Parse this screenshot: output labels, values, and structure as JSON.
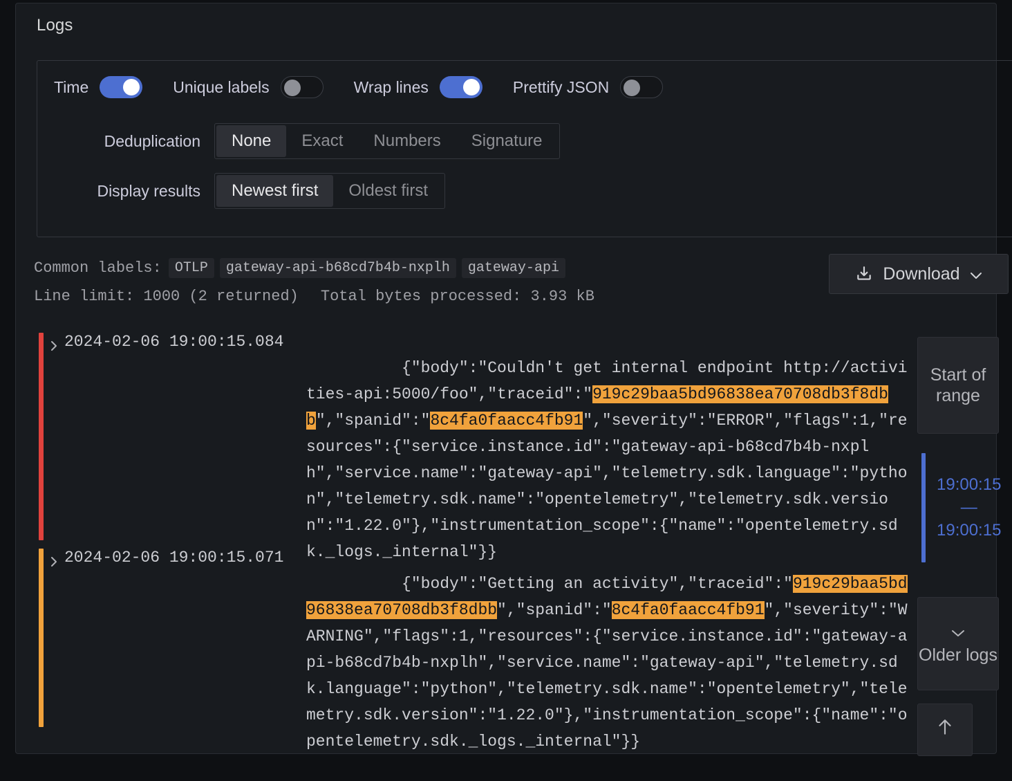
{
  "panel": {
    "title": "Logs"
  },
  "options": {
    "toggles": [
      {
        "label": "Time",
        "state": "on",
        "icon": "toggle-switch"
      },
      {
        "label": "Unique labels",
        "state": "off",
        "icon": "toggle-switch"
      },
      {
        "label": "Wrap lines",
        "state": "on",
        "icon": "toggle-switch"
      },
      {
        "label": "Prettify JSON",
        "state": "off",
        "icon": "toggle-switch"
      }
    ],
    "deduplication": {
      "label": "Deduplication",
      "options": [
        "None",
        "Exact",
        "Numbers",
        "Signature"
      ],
      "selected": "None"
    },
    "display_results": {
      "label": "Display results",
      "options": [
        "Newest first",
        "Oldest first"
      ],
      "selected": "Newest first"
    }
  },
  "meta": {
    "common_labels_key": "Common labels:",
    "common_labels": [
      "OTLP",
      "gateway-api-b68cd7b4b-nxplh",
      "gateway-api"
    ],
    "line_limit": "Line limit: 1000 (2 returned)",
    "total_bytes": "Total bytes processed: 3.93 kB"
  },
  "download": {
    "label": "Download",
    "icon": "download-icon",
    "caret": "chevron-down-icon"
  },
  "logs": [
    {
      "timestamp": "2024-02-06 19:00:15.084",
      "severity": "ERROR",
      "severity_color": "#e0423d",
      "segments": [
        {
          "text": "{\"body\":\"Couldn't get internal endpoint http://activities-api:5000/foo\",\"traceid\":\"",
          "highlight": false
        },
        {
          "text": "919c29baa5bd96838ea70708db3f8dbb",
          "highlight": true
        },
        {
          "text": "\",\"spanid\":\"",
          "highlight": false
        },
        {
          "text": "8c4fa0faacc4fb91",
          "highlight": true
        },
        {
          "text": "\",\"severity\":\"ERROR\",\"flags\":1,\"resources\":{\"service.instance.id\":\"gateway-api-b68cd7b4b-nxplh\",\"service.name\":\"gateway-api\",\"telemetry.sdk.language\":\"python\",\"telemetry.sdk.name\":\"opentelemetry\",\"telemetry.sdk.version\":\"1.22.0\"},\"instrumentation_scope\":{\"name\":\"opentelemetry.sdk._logs._internal\"}}",
          "highlight": false
        }
      ]
    },
    {
      "timestamp": "2024-02-06 19:00:15.071",
      "severity": "WARNING",
      "severity_color": "#f0a23c",
      "segments": [
        {
          "text": "{\"body\":\"Getting an activity\",\"traceid\":\"",
          "highlight": false
        },
        {
          "text": "919c29baa5bd96838ea70708db3f8dbb",
          "highlight": true
        },
        {
          "text": "\",\"spanid\":\"",
          "highlight": false
        },
        {
          "text": "8c4fa0faacc4fb91",
          "highlight": true
        },
        {
          "text": "\",\"severity\":\"WARNING\",\"flags\":1,\"resources\":{\"service.instance.id\":\"gateway-api-b68cd7b4b-nxplh\",\"service.name\":\"gateway-api\",\"telemetry.sdk.language\":\"python\",\"telemetry.sdk.name\":\"opentelemetry\",\"telemetry.sdk.version\":\"1.22.0\"},\"instrumentation_scope\":{\"name\":\"opentelemetry.sdk._logs._internal\"}}",
          "highlight": false
        }
      ]
    }
  ],
  "rail": {
    "start_of_range": "Start of range",
    "time_range_start": "19:00:15",
    "time_range_end": "19:00:15",
    "time_range_dash": "—",
    "older_logs": "Older logs",
    "older_logs_icon": "chevron-down-icon",
    "scroll_to_top_icon": "arrow-up-icon"
  },
  "colors": {
    "accent_blue": "#4d6fd1",
    "highlight_orange": "#f0a23c",
    "error_red": "#e0423d",
    "panel_bg": "#181b1f"
  }
}
